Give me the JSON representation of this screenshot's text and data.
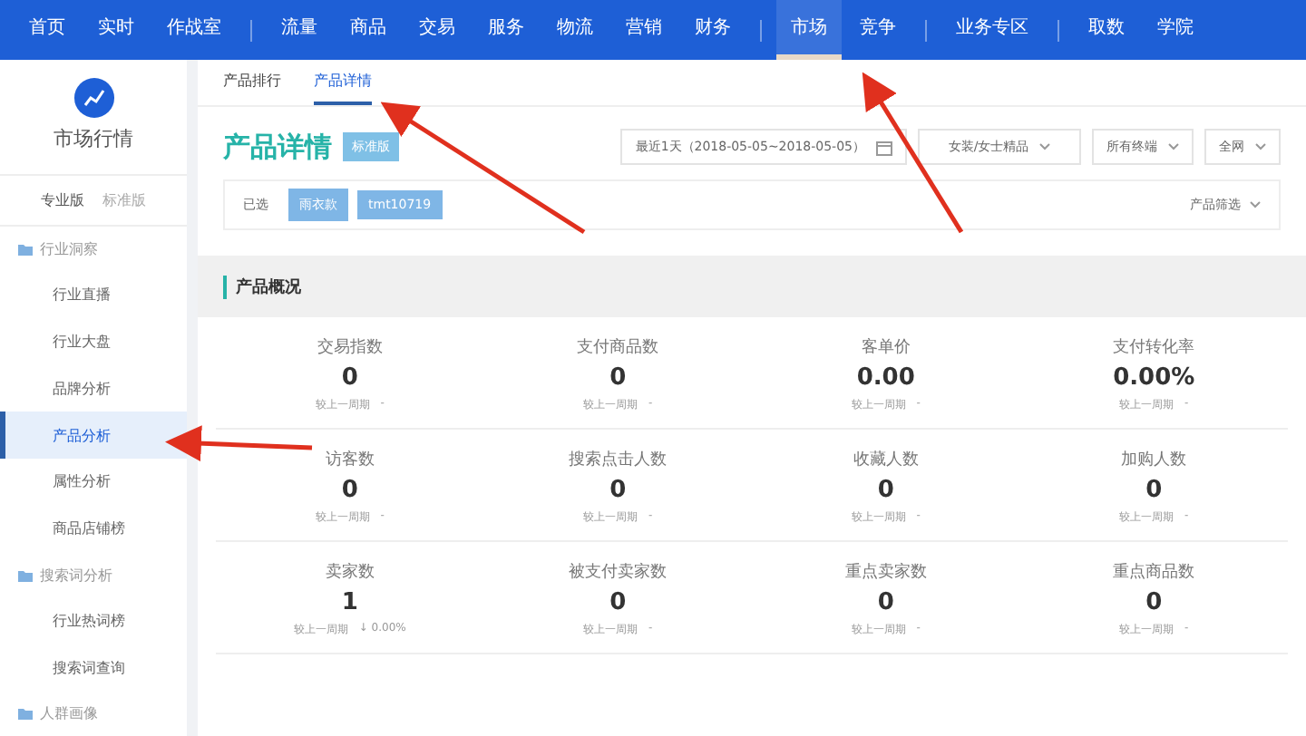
{
  "nav": {
    "groups": [
      [
        {
          "label": "首页",
          "selected": false
        },
        {
          "label": "实时",
          "selected": false
        },
        {
          "label": "作战室",
          "selected": false
        }
      ],
      [
        {
          "label": "流量",
          "selected": false
        },
        {
          "label": "商品",
          "selected": false
        },
        {
          "label": "交易",
          "selected": false
        },
        {
          "label": "服务",
          "selected": false
        },
        {
          "label": "物流",
          "selected": false
        },
        {
          "label": "营销",
          "selected": false
        },
        {
          "label": "财务",
          "selected": false
        }
      ],
      [
        {
          "label": "市场",
          "selected": true
        },
        {
          "label": "竞争",
          "selected": false
        }
      ],
      [
        {
          "label": "业务专区",
          "selected": false
        }
      ],
      [
        {
          "label": "取数",
          "selected": false
        },
        {
          "label": "学院",
          "selected": false
        }
      ]
    ]
  },
  "sidebar": {
    "title": "市场行情",
    "editions": [
      {
        "label": "专业版",
        "selected": true
      },
      {
        "label": "标准版",
        "selected": false
      }
    ],
    "sections": [
      {
        "label": "行业洞察",
        "items": [
          {
            "label": "行业直播",
            "selected": false
          },
          {
            "label": "行业大盘",
            "selected": false
          },
          {
            "label": "品牌分析",
            "selected": false
          },
          {
            "label": "产品分析",
            "selected": true
          },
          {
            "label": "属性分析",
            "selected": false
          },
          {
            "label": "商品店铺榜",
            "selected": false
          }
        ]
      },
      {
        "label": "搜索词分析",
        "items": [
          {
            "label": "行业热词榜",
            "selected": false
          },
          {
            "label": "搜索词查询",
            "selected": false
          }
        ]
      },
      {
        "label": "人群画像"
      }
    ]
  },
  "tabs": [
    {
      "label": "产品排行",
      "selected": false
    },
    {
      "label": "产品详情",
      "selected": true
    }
  ],
  "header": {
    "title": "产品详情",
    "badge": "标准版",
    "date_range": "最近1天（2018-05-05~2018-05-05）",
    "category": "女装/女士精品",
    "terminal": "所有终端",
    "channel": "全网"
  },
  "filter": {
    "label": "已选",
    "chips": [
      "雨衣款",
      "tmt10719"
    ],
    "product_filter": "产品筛选"
  },
  "overview": {
    "title": "产品概况",
    "metrics": [
      [
        {
          "name": "交易指数",
          "value": "0",
          "compare": "较上一周期",
          "change": "-"
        },
        {
          "name": "支付商品数",
          "value": "0",
          "compare": "较上一周期",
          "change": "-"
        },
        {
          "name": "客单价",
          "value": "0.00",
          "compare": "较上一周期",
          "change": "-"
        },
        {
          "name": "支付转化率",
          "value": "0.00%",
          "compare": "较上一周期",
          "change": "-"
        }
      ],
      [
        {
          "name": "访客数",
          "value": "0",
          "compare": "较上一周期",
          "change": "-"
        },
        {
          "name": "搜索点击人数",
          "value": "0",
          "compare": "较上一周期",
          "change": "-"
        },
        {
          "name": "收藏人数",
          "value": "0",
          "compare": "较上一周期",
          "change": "-"
        },
        {
          "name": "加购人数",
          "value": "0",
          "compare": "较上一周期",
          "change": "-"
        }
      ],
      [
        {
          "name": "卖家数",
          "value": "1",
          "compare": "较上一周期",
          "change": "↓ 0.00%"
        },
        {
          "name": "被支付卖家数",
          "value": "0",
          "compare": "较上一周期",
          "change": "-"
        },
        {
          "name": "重点卖家数",
          "value": "0",
          "compare": "较上一周期",
          "change": "-"
        },
        {
          "name": "重点商品数",
          "value": "0",
          "compare": "较上一周期",
          "change": "-"
        }
      ]
    ]
  }
}
